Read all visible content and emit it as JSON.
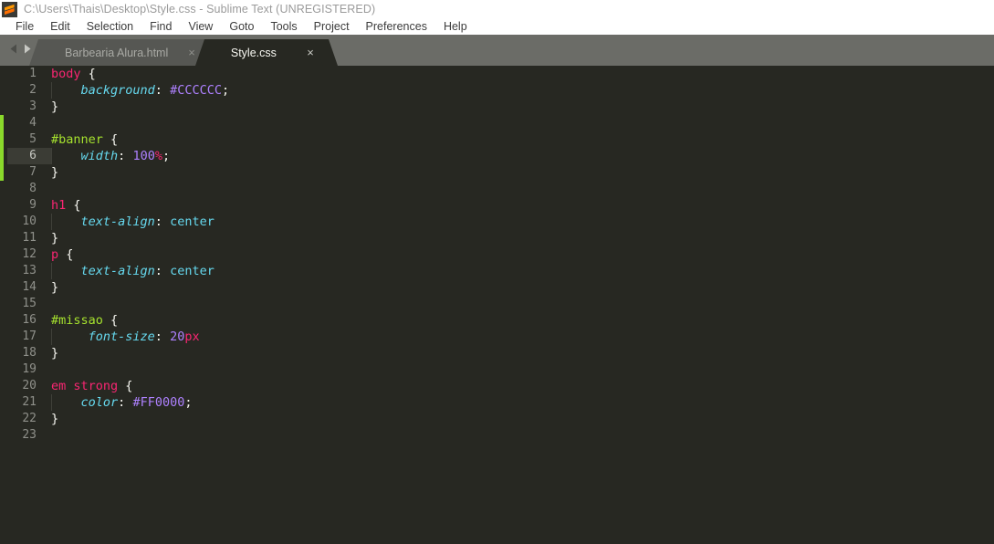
{
  "window": {
    "title": "C:\\Users\\Thais\\Desktop\\Style.css - Sublime Text (UNREGISTERED)",
    "logo_icon": "sublime-text-logo-icon"
  },
  "menu": {
    "items": [
      {
        "label": "File"
      },
      {
        "label": "Edit"
      },
      {
        "label": "Selection"
      },
      {
        "label": "Find"
      },
      {
        "label": "View"
      },
      {
        "label": "Goto"
      },
      {
        "label": "Tools"
      },
      {
        "label": "Project"
      },
      {
        "label": "Preferences"
      },
      {
        "label": "Help"
      }
    ]
  },
  "tab_nav": {
    "prev_icon": "chevron-left-icon",
    "next_icon": "chevron-right-icon"
  },
  "tabs": [
    {
      "label": "Barbearia Alura.html",
      "close_icon": "×",
      "active": false
    },
    {
      "label": "Style.css",
      "close_icon": "×",
      "active": true
    }
  ],
  "editor": {
    "current_line": 6,
    "modified_marker_color": "#8ad92b",
    "background": "#272822",
    "gutter_color": "#8f908a",
    "lines": [
      {
        "n": "1",
        "indent": 0,
        "tokens": [
          {
            "t": "body",
            "c": "tk-sel"
          },
          {
            "t": " ",
            "c": "tk-punc"
          },
          {
            "t": "{",
            "c": "tk-punc"
          }
        ]
      },
      {
        "n": "2",
        "indent": 1,
        "tokens": [
          {
            "t": "    ",
            "c": "tk-punc"
          },
          {
            "t": "background",
            "c": "tk-prop"
          },
          {
            "t": ":",
            "c": "tk-punc"
          },
          {
            "t": " ",
            "c": "tk-punc"
          },
          {
            "t": "#CCCCCC",
            "c": "tk-num"
          },
          {
            "t": ";",
            "c": "tk-punc"
          }
        ]
      },
      {
        "n": "3",
        "indent": 0,
        "tokens": [
          {
            "t": "}",
            "c": "tk-punc"
          }
        ]
      },
      {
        "n": "4",
        "indent": 0,
        "tokens": []
      },
      {
        "n": "5",
        "indent": 0,
        "tokens": [
          {
            "t": "#banner",
            "c": "tk-id"
          },
          {
            "t": " ",
            "c": "tk-punc"
          },
          {
            "t": "{",
            "c": "tk-punc"
          }
        ]
      },
      {
        "n": "6",
        "indent": 1,
        "tokens": [
          {
            "t": "    ",
            "c": "tk-punc"
          },
          {
            "t": "width",
            "c": "tk-prop"
          },
          {
            "t": ":",
            "c": "tk-punc"
          },
          {
            "t": " ",
            "c": "tk-punc"
          },
          {
            "t": "100",
            "c": "tk-num"
          },
          {
            "t": "%",
            "c": "tk-unit"
          },
          {
            "t": ";",
            "c": "tk-punc"
          }
        ]
      },
      {
        "n": "7",
        "indent": 0,
        "tokens": [
          {
            "t": "}",
            "c": "tk-punc"
          }
        ]
      },
      {
        "n": "8",
        "indent": 0,
        "tokens": []
      },
      {
        "n": "9",
        "indent": 0,
        "tokens": [
          {
            "t": "h1",
            "c": "tk-sel"
          },
          {
            "t": " ",
            "c": "tk-punc"
          },
          {
            "t": "{",
            "c": "tk-punc"
          }
        ]
      },
      {
        "n": "10",
        "indent": 1,
        "tokens": [
          {
            "t": "    ",
            "c": "tk-punc"
          },
          {
            "t": "text-align",
            "c": "tk-prop"
          },
          {
            "t": ":",
            "c": "tk-punc"
          },
          {
            "t": " ",
            "c": "tk-punc"
          },
          {
            "t": "center",
            "c": "tk-val"
          }
        ]
      },
      {
        "n": "11",
        "indent": 0,
        "tokens": [
          {
            "t": "}",
            "c": "tk-punc"
          }
        ]
      },
      {
        "n": "12",
        "indent": 0,
        "tokens": [
          {
            "t": "p",
            "c": "tk-sel"
          },
          {
            "t": " ",
            "c": "tk-punc"
          },
          {
            "t": "{",
            "c": "tk-punc"
          }
        ]
      },
      {
        "n": "13",
        "indent": 1,
        "tokens": [
          {
            "t": "    ",
            "c": "tk-punc"
          },
          {
            "t": "text-align",
            "c": "tk-prop"
          },
          {
            "t": ":",
            "c": "tk-punc"
          },
          {
            "t": " ",
            "c": "tk-punc"
          },
          {
            "t": "center",
            "c": "tk-val"
          }
        ]
      },
      {
        "n": "14",
        "indent": 0,
        "tokens": [
          {
            "t": "}",
            "c": "tk-punc"
          }
        ]
      },
      {
        "n": "15",
        "indent": 0,
        "tokens": []
      },
      {
        "n": "16",
        "indent": 0,
        "tokens": [
          {
            "t": "#missao",
            "c": "tk-id"
          },
          {
            "t": " ",
            "c": "tk-punc"
          },
          {
            "t": "{",
            "c": "tk-punc"
          }
        ]
      },
      {
        "n": "17",
        "indent": 1,
        "tokens": [
          {
            "t": "     ",
            "c": "tk-punc"
          },
          {
            "t": "font-size",
            "c": "tk-prop"
          },
          {
            "t": ":",
            "c": "tk-punc"
          },
          {
            "t": " ",
            "c": "tk-punc"
          },
          {
            "t": "20",
            "c": "tk-num"
          },
          {
            "t": "px",
            "c": "tk-unit"
          }
        ]
      },
      {
        "n": "18",
        "indent": 0,
        "tokens": [
          {
            "t": "}",
            "c": "tk-punc"
          }
        ]
      },
      {
        "n": "19",
        "indent": 0,
        "tokens": []
      },
      {
        "n": "20",
        "indent": 0,
        "tokens": [
          {
            "t": "em strong",
            "c": "tk-sel"
          },
          {
            "t": " ",
            "c": "tk-punc"
          },
          {
            "t": "{",
            "c": "tk-punc"
          }
        ]
      },
      {
        "n": "21",
        "indent": 1,
        "tokens": [
          {
            "t": "    ",
            "c": "tk-punc"
          },
          {
            "t": "color",
            "c": "tk-prop"
          },
          {
            "t": ":",
            "c": "tk-punc"
          },
          {
            "t": " ",
            "c": "tk-punc"
          },
          {
            "t": "#FF0000",
            "c": "tk-num"
          },
          {
            "t": ";",
            "c": "tk-punc"
          }
        ]
      },
      {
        "n": "22",
        "indent": 0,
        "tokens": [
          {
            "t": "}",
            "c": "tk-punc"
          }
        ]
      },
      {
        "n": "23",
        "indent": 0,
        "tokens": []
      }
    ],
    "modified_ranges": [
      {
        "from_line": 4,
        "to_line": 7
      }
    ]
  }
}
